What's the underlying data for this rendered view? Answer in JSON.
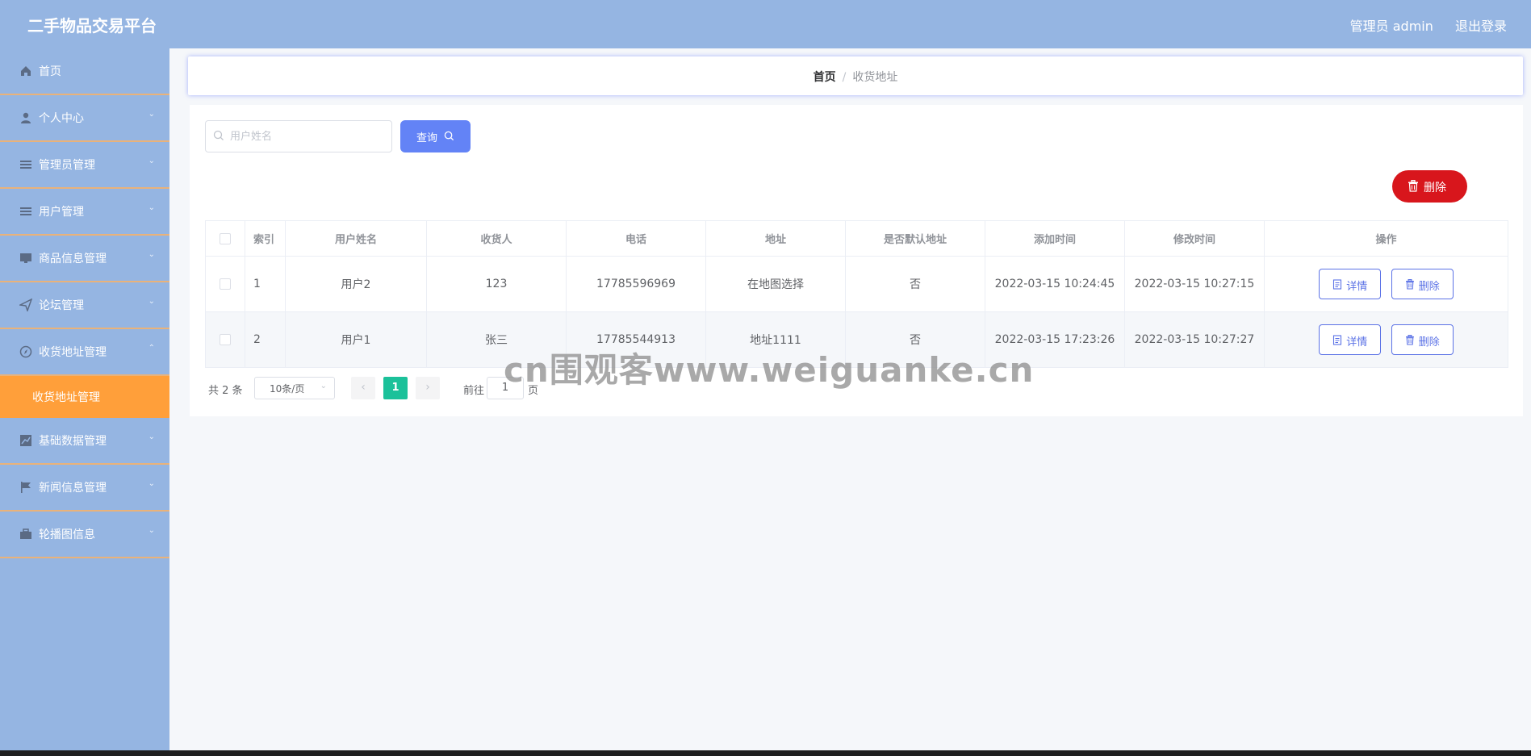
{
  "header": {
    "title": "二手物品交易平台",
    "user_label": "管理员 admin",
    "logout_label": "退出登录"
  },
  "sidebar": {
    "items": [
      {
        "label": "首页",
        "icon": "home-icon",
        "has_chevron": false
      },
      {
        "label": "个人中心",
        "icon": "user-icon",
        "has_chevron": true
      },
      {
        "label": "管理员管理",
        "icon": "list-icon",
        "has_chevron": true
      },
      {
        "label": "用户管理",
        "icon": "list-icon",
        "has_chevron": true
      },
      {
        "label": "商品信息管理",
        "icon": "monitor-icon",
        "has_chevron": true
      },
      {
        "label": "论坛管理",
        "icon": "send-icon",
        "has_chevron": true
      },
      {
        "label": "收货地址管理",
        "icon": "compass-icon",
        "has_chevron": true
      },
      {
        "label": "基础数据管理",
        "icon": "chart-icon",
        "has_chevron": true
      },
      {
        "label": "新闻信息管理",
        "icon": "flag-icon",
        "has_chevron": true
      },
      {
        "label": "轮播图信息",
        "icon": "briefcase-icon",
        "has_chevron": true
      }
    ],
    "active_submenu": "收货地址管理"
  },
  "breadcrumb": {
    "home": "首页",
    "separator": "/",
    "current": "收货地址"
  },
  "search": {
    "placeholder": "用户姓名",
    "value": "",
    "query_label": "查询"
  },
  "toolbar": {
    "delete_label": "删除"
  },
  "table": {
    "headers": [
      "索引",
      "用户姓名",
      "收货人",
      "电话",
      "地址",
      "是否默认地址",
      "添加时间",
      "修改时间",
      "操作"
    ],
    "rows": [
      {
        "index": "1",
        "username": "用户2",
        "receiver": "123",
        "phone": "17785596969",
        "address": "在地图选择",
        "is_default": "否",
        "created": "2022-03-15 10:24:45",
        "updated": "2022-03-15 10:27:15"
      },
      {
        "index": "2",
        "username": "用户1",
        "receiver": "张三",
        "phone": "17785544913",
        "address": "地址1111",
        "is_default": "否",
        "created": "2022-03-15 17:23:26",
        "updated": "2022-03-15 10:27:27"
      }
    ],
    "detail_label": "详情",
    "delete_label": "删除"
  },
  "pagination": {
    "total": "共 2 条",
    "page_size": "10条/页",
    "current_page": "1",
    "goto_label": "前往",
    "goto_value": "1",
    "goto_suffix": "页"
  },
  "watermark": "cn围观客www.weiguanke.cn",
  "colors": {
    "header_bg": "#95b5e2",
    "active_menu": "#ff9f3a",
    "primary": "#6383f6",
    "danger": "#d8161c",
    "page_active": "#1bc19a"
  }
}
